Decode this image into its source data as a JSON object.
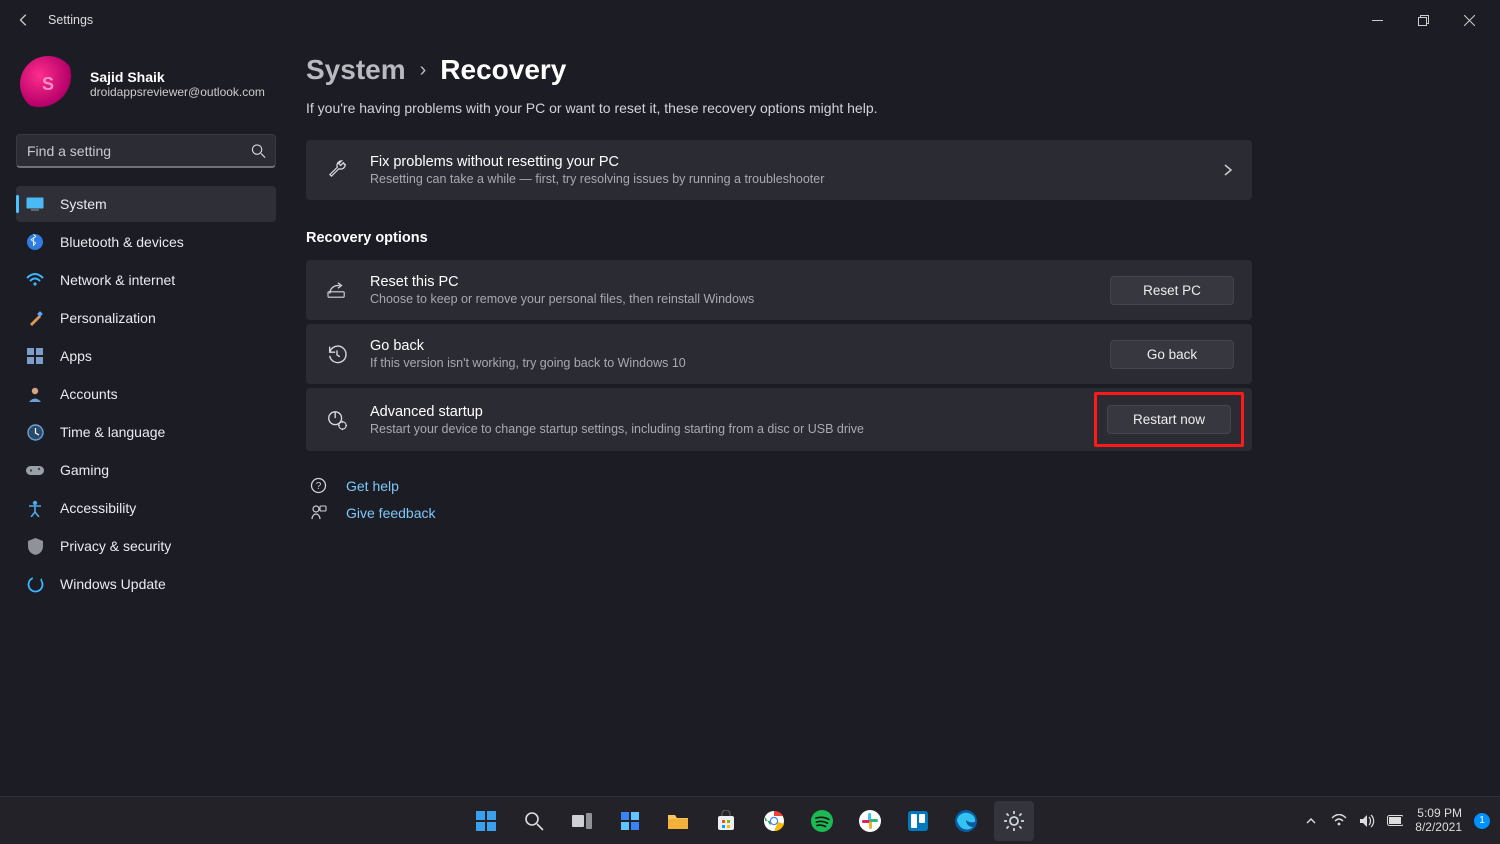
{
  "window": {
    "title": "Settings"
  },
  "user": {
    "name": "Sajid Shaik",
    "email": "droidappsreviewer@outlook.com"
  },
  "search": {
    "placeholder": "Find a setting"
  },
  "sidebar": {
    "items": [
      {
        "label": "System"
      },
      {
        "label": "Bluetooth & devices"
      },
      {
        "label": "Network & internet"
      },
      {
        "label": "Personalization"
      },
      {
        "label": "Apps"
      },
      {
        "label": "Accounts"
      },
      {
        "label": "Time & language"
      },
      {
        "label": "Gaming"
      },
      {
        "label": "Accessibility"
      },
      {
        "label": "Privacy & security"
      },
      {
        "label": "Windows Update"
      }
    ]
  },
  "breadcrumb": {
    "parent": "System",
    "current": "Recovery"
  },
  "intro": "If you're having problems with your PC or want to reset it, these recovery options might help.",
  "fixcard": {
    "title": "Fix problems without resetting your PC",
    "desc": "Resetting can take a while — first, try resolving issues by running a troubleshooter"
  },
  "options_header": "Recovery options",
  "options": [
    {
      "title": "Reset this PC",
      "desc": "Choose to keep or remove your personal files, then reinstall Windows",
      "button": "Reset PC"
    },
    {
      "title": "Go back",
      "desc": "If this version isn't working, try going back to Windows 10",
      "button": "Go back"
    },
    {
      "title": "Advanced startup",
      "desc": "Restart your device to change startup settings, including starting from a disc or USB drive",
      "button": "Restart now"
    }
  ],
  "footer": {
    "help": "Get help",
    "feedback": "Give feedback"
  },
  "taskbar": {
    "time": "5:09 PM",
    "date": "8/2/2021",
    "notif_count": "1"
  }
}
